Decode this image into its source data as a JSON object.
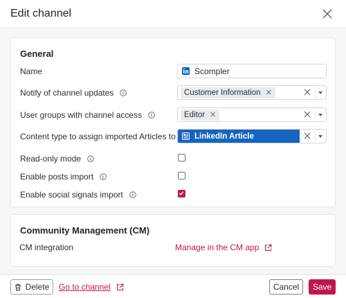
{
  "dialog": {
    "title": "Edit channel"
  },
  "general": {
    "section_title": "General",
    "name": {
      "label": "Name",
      "value": "Scompler"
    },
    "notify": {
      "label": "Notify of channel updates",
      "tags": [
        "Customer Information"
      ]
    },
    "user_groups": {
      "label": "User groups with channel access",
      "tags": [
        "Editor"
      ]
    },
    "content_type": {
      "label": "Content type to assign imported Articles to",
      "selected": "LinkedIn Article"
    },
    "read_only": {
      "label": "Read-only mode",
      "checked": false
    },
    "posts_import": {
      "label": "Enable posts import",
      "checked": false
    },
    "social_signals": {
      "label": "Enable social signals import",
      "checked": true
    }
  },
  "community_management": {
    "section_title": "Community Management (CM)",
    "integration_label": "CM integration",
    "manage_link": "Manage in the CM app"
  },
  "footer": {
    "delete_label": "Delete",
    "goto_label": "Go to channel",
    "cancel_label": "Cancel",
    "save_label": "Save"
  },
  "colors": {
    "accent": "#c0174f",
    "selection": "#1565c0",
    "background": "#f4f6f8"
  },
  "icons": [
    "close-icon",
    "info-icon",
    "linkedin-icon",
    "article-icon",
    "external-link-icon",
    "trash-icon",
    "chevron-down-icon"
  ]
}
